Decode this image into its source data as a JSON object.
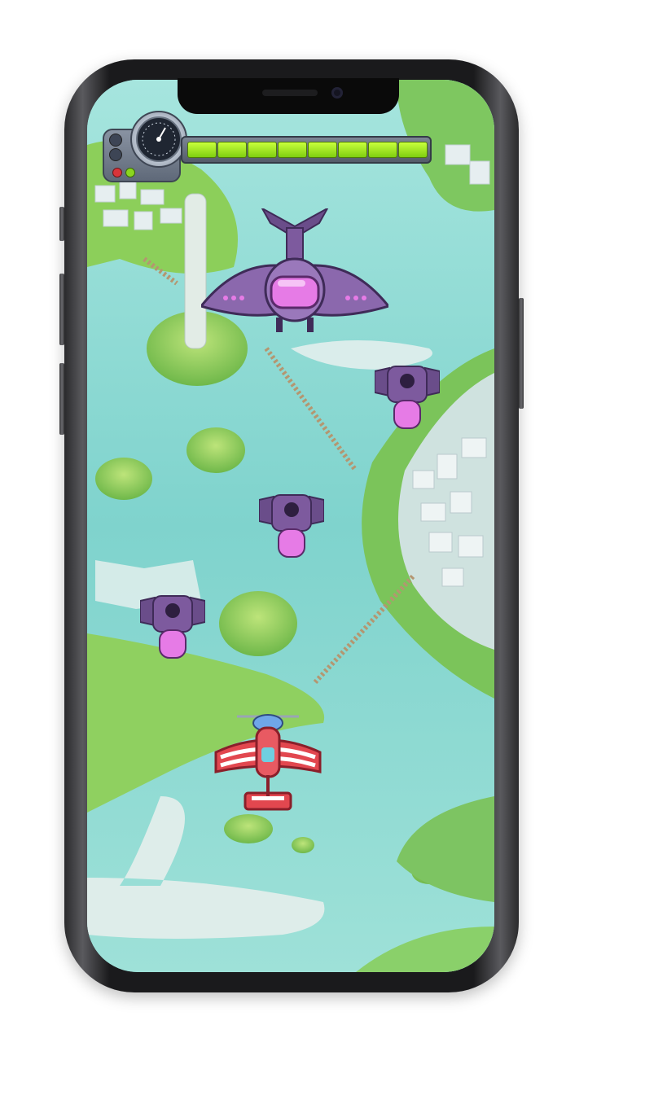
{
  "hud": {
    "health": {
      "segments_total": 8,
      "segments_filled": 8
    },
    "indicator_lights": [
      "#d9343a",
      "#8bd61e"
    ],
    "gauge_icon": "speedometer-icon"
  },
  "enemies": {
    "boss": {
      "icon": "purple-boss-airship-icon"
    },
    "drones": [
      {
        "icon": "skull-drone-icon"
      },
      {
        "icon": "skull-drone-icon"
      },
      {
        "icon": "skull-drone-icon"
      }
    ]
  },
  "player": {
    "icon": "red-biplane-icon"
  },
  "colors": {
    "water": "#8ad8d3",
    "land": "#8ccf5a",
    "enemy_purple": "#7d5a9e",
    "enemy_glow": "#e67be6",
    "player_red": "#e2474f"
  }
}
